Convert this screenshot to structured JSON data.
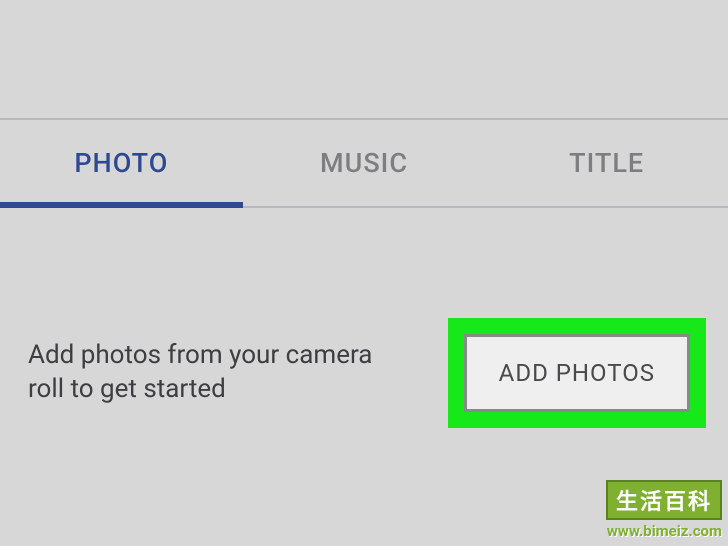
{
  "tabs": {
    "photo": "PHOTO",
    "music": "MUSIC",
    "title": "TITLE"
  },
  "content": {
    "instruction": "Add photos from your camera roll to get started",
    "add_button_label": "ADD PHOTOS"
  },
  "watermark": {
    "cn_text": "生活百科",
    "url": "www.bimeiz.com"
  }
}
